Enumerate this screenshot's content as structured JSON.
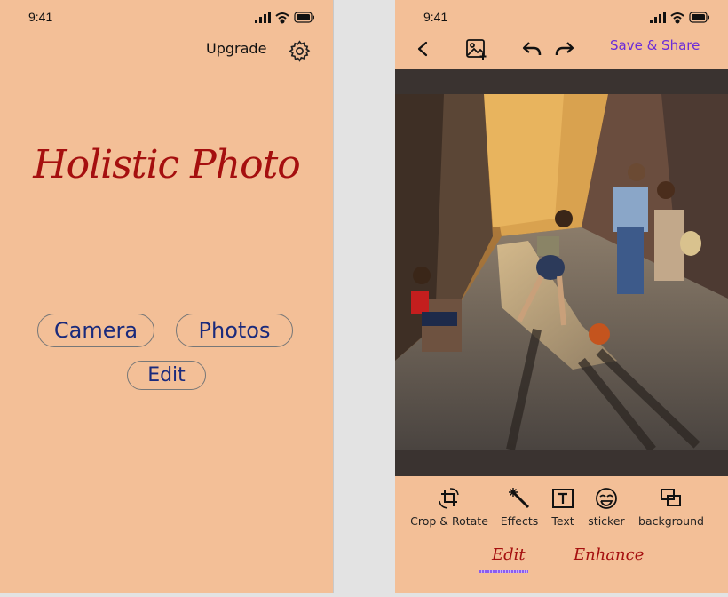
{
  "colors": {
    "background": "#f3bf97",
    "title": "#a50f0f",
    "button_text": "#1a2a7c",
    "accent": "#6b2bd9",
    "canvas": "#3a3330"
  },
  "home": {
    "status_time": "9:41",
    "upgrade_label": "Upgrade",
    "app_title": "Holistic Photo",
    "camera_label": "Camera",
    "photos_label": "Photos",
    "edit_label": "Edit"
  },
  "editor": {
    "status_time": "9:41",
    "save_share_label": "Save & Share",
    "tools": [
      {
        "label": "Crop & Rotate",
        "icon": "crop-rotate-icon"
      },
      {
        "label": "Effects",
        "icon": "magic-wand-icon"
      },
      {
        "label": "Text",
        "icon": "text-box-icon"
      },
      {
        "label": "sticker",
        "icon": "sticker-face-icon"
      },
      {
        "label": "background",
        "icon": "background-layers-icon"
      }
    ],
    "tabs": [
      {
        "label": "Edit",
        "active": true
      },
      {
        "label": "Enhance",
        "active": false
      }
    ]
  }
}
